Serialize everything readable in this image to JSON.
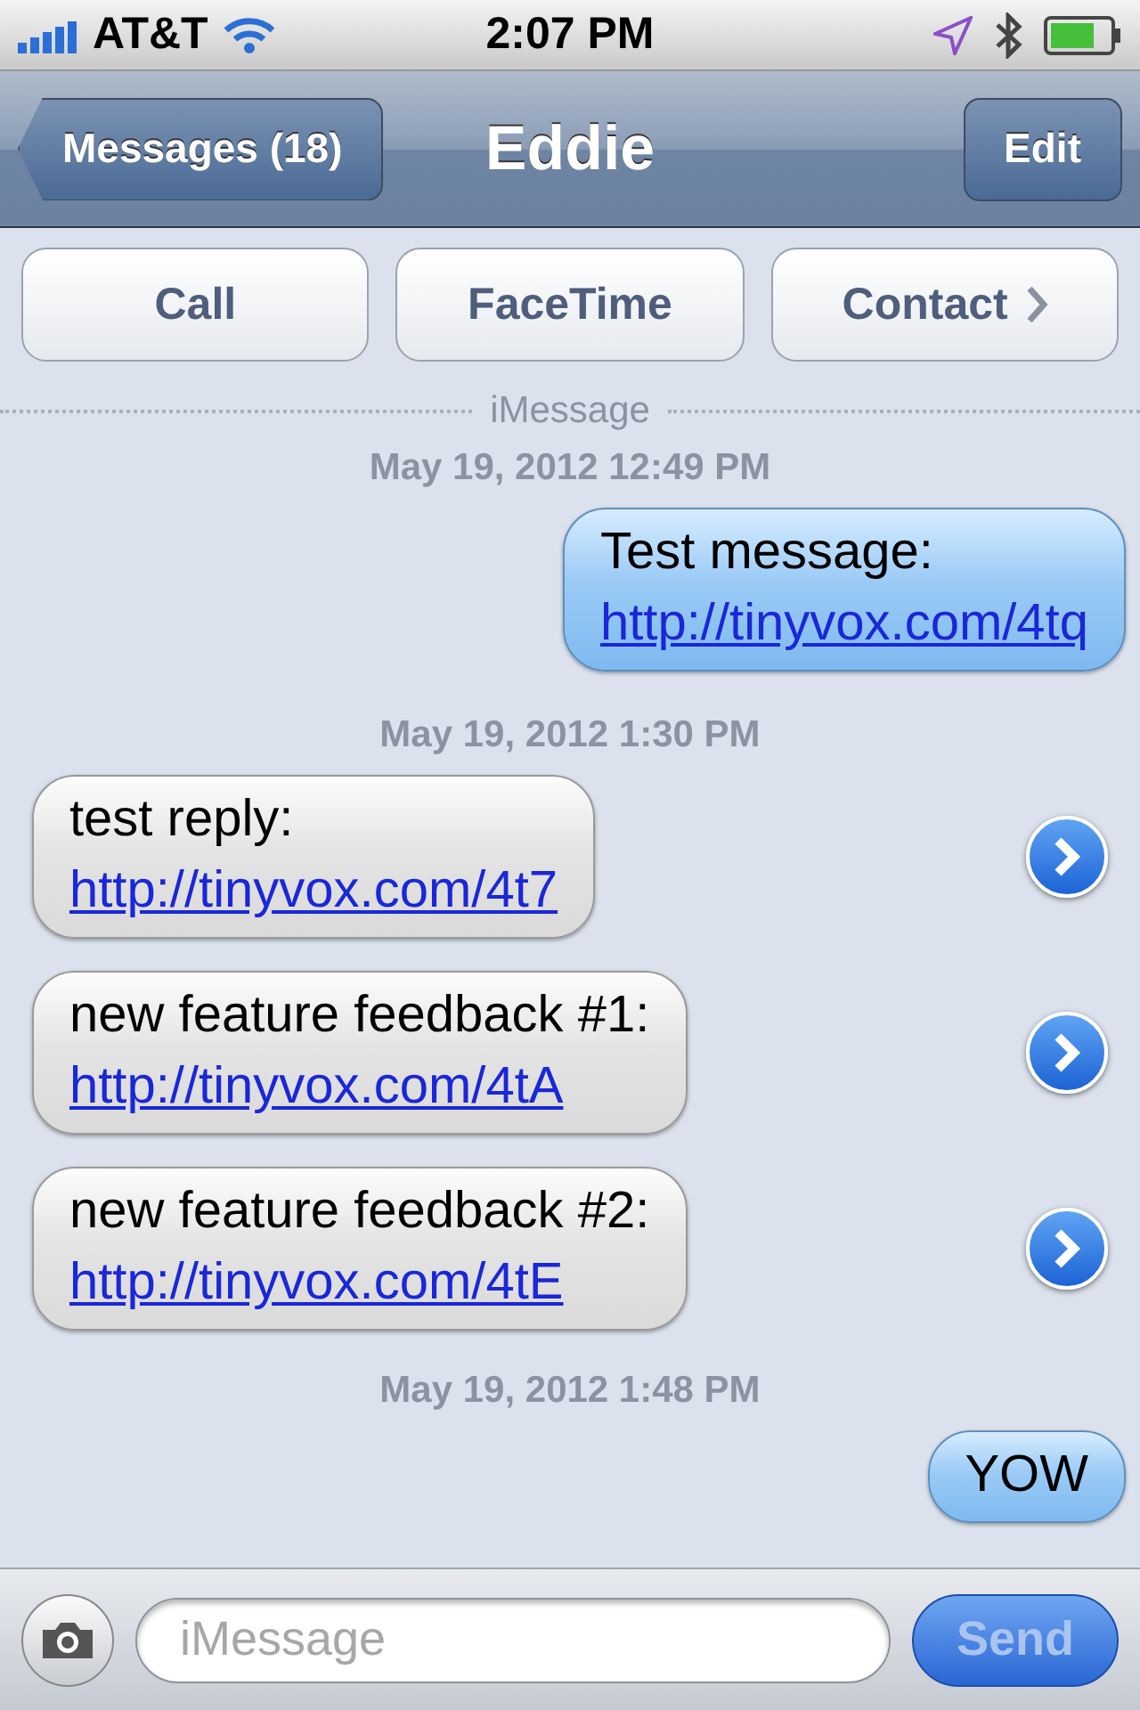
{
  "status_bar": {
    "carrier": "AT&T",
    "time": "2:07 PM"
  },
  "nav_bar": {
    "back": "Messages (18)",
    "title": "Eddie",
    "edit": "Edit"
  },
  "actions": [
    {
      "label": "Call",
      "chevron": false
    },
    {
      "label": "FaceTime",
      "chevron": false
    },
    {
      "label": "Contact",
      "chevron": true
    }
  ],
  "thread": {
    "service": "iMessage",
    "items": [
      {
        "kind": "timestamp",
        "text": "May 19, 2012 12:49 PM"
      },
      {
        "kind": "message",
        "outgoing": true,
        "detail_button": false,
        "lines": [
          {
            "kind": "text",
            "text": "Test message:"
          },
          {
            "kind": "link",
            "text": "http://tinyvox.com/4tq"
          }
        ]
      },
      {
        "kind": "timestamp",
        "text": "May 19, 2012 1:30 PM"
      },
      {
        "kind": "message",
        "outgoing": false,
        "detail_button": true,
        "lines": [
          {
            "kind": "text",
            "text": "test reply:"
          },
          {
            "kind": "link",
            "text": "http://tinyvox.com/4t7"
          }
        ]
      },
      {
        "kind": "message",
        "outgoing": false,
        "detail_button": true,
        "lines": [
          {
            "kind": "text",
            "text": "new feature feedback #1:"
          },
          {
            "kind": "link",
            "text": "http://tinyvox.com/4tA"
          }
        ]
      },
      {
        "kind": "message",
        "outgoing": false,
        "detail_button": true,
        "lines": [
          {
            "kind": "text",
            "text": "new feature feedback #2:"
          },
          {
            "kind": "link",
            "text": "http://tinyvox.com/4tE"
          }
        ]
      },
      {
        "kind": "timestamp",
        "text": "May 19, 2012 1:48 PM"
      },
      {
        "kind": "message",
        "outgoing": true,
        "detail_button": false,
        "lines": [
          {
            "kind": "text",
            "text": "YOW"
          }
        ]
      }
    ]
  },
  "compose": {
    "placeholder": "iMessage",
    "send": "Send"
  }
}
